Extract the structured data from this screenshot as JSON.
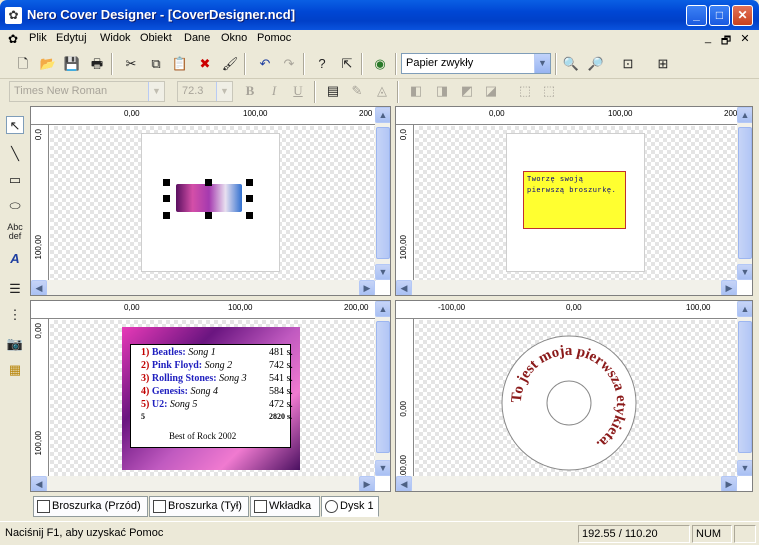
{
  "window": {
    "title": "Nero Cover Designer - [CoverDesigner.ncd]",
    "minimize": "_",
    "maximize": "□",
    "close": "✕"
  },
  "menu": {
    "items": [
      "Plik",
      "Edytuj",
      "Widok",
      "Obiekt",
      "Dane",
      "Okno",
      "Pomoc"
    ],
    "mdi": [
      "_",
      "🗗",
      "✕"
    ]
  },
  "toolbar": {
    "paper_select": "Papier zwykły",
    "icons": [
      "new-icon",
      "open-icon",
      "save-icon",
      "print-icon",
      "cut-icon",
      "copy-icon",
      "paste-icon",
      "delete-icon",
      "format-painter-icon",
      "undo-icon",
      "redo-icon",
      "help-icon",
      "context-help-icon",
      "nero-icon",
      "zoom-in-icon",
      "zoom-out-icon",
      "zoom-page-icon",
      "zoom-selection-icon"
    ]
  },
  "format_toolbar": {
    "font": "Times New Roman",
    "size": "72.3",
    "bold": "B",
    "italic": "I",
    "underline": "U"
  },
  "left_tools": [
    "pointer-icon",
    "line-icon",
    "rectangle-icon",
    "ellipse-icon",
    "text-icon",
    "artistic-text-icon",
    "list-icon",
    "tracklist-icon",
    "image-icon",
    "field-icon"
  ],
  "tools_text": {
    "text_tool": "Abc\ndef"
  },
  "panes": {
    "front": {
      "ruler_x": [
        "0,00",
        "100,00",
        "200"
      ],
      "ruler_y": [
        "0,0",
        "100,00"
      ]
    },
    "back": {
      "ruler_x": [
        "0,00",
        "100,00",
        "200"
      ],
      "ruler_y": [
        "0,0",
        "100,00"
      ],
      "text": "Tworzę swoją pierwszą broszurkę."
    },
    "inlay": {
      "ruler_x": [
        "0,00",
        "100,00",
        "200,00"
      ],
      "ruler_y": [
        "0,00",
        "100,00"
      ],
      "songs": [
        {
          "num": "1)",
          "band": "Beatles:",
          "title": "Song 1",
          "sec": "481 s."
        },
        {
          "num": "2)",
          "band": "Pink Floyd:",
          "title": "Song 2",
          "sec": "742 s."
        },
        {
          "num": "3)",
          "band": "Rolling Stones:",
          "title": "Song 3",
          "sec": "541 s."
        },
        {
          "num": "4)",
          "band": "Genesis:",
          "title": "Song 4",
          "sec": "584 s."
        },
        {
          "num": "5)",
          "band": "U2:",
          "title": "Song 5",
          "sec": "472 s."
        }
      ],
      "total_count": "5",
      "total_sec": "2820 s.",
      "footer": "Best of Rock 2002"
    },
    "disc": {
      "ruler_x": [
        "-100,00",
        "0,00",
        "100,00"
      ],
      "ruler_y": [
        "0,00",
        "100,00"
      ],
      "curved_text": "To jest moja pierwsza etykieta."
    }
  },
  "tabs": [
    {
      "label": "Broszurka  (Przód)"
    },
    {
      "label": "Broszurka  (Tył)"
    },
    {
      "label": "Wkładka"
    },
    {
      "label": "Dysk 1"
    }
  ],
  "status": {
    "hint": "Naciśnij F1, aby uzyskać Pomoc",
    "coords": "192.55 / 110.20",
    "num": "NUM"
  }
}
